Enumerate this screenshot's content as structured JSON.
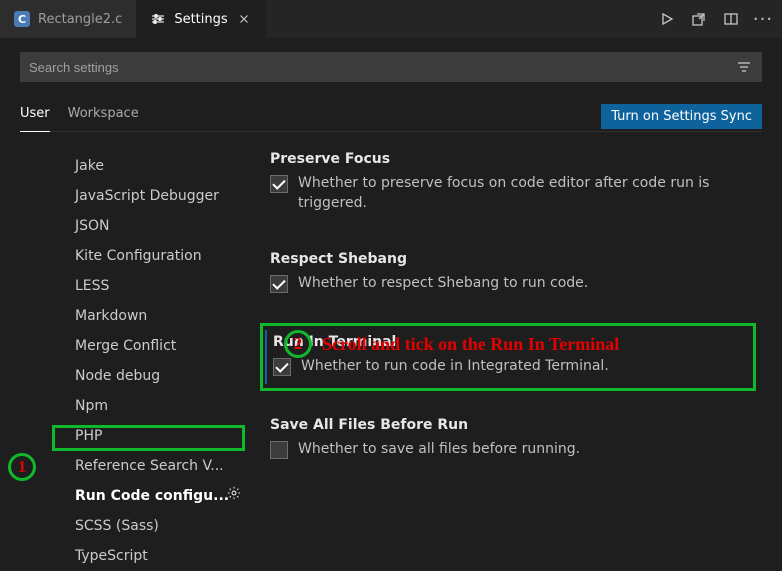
{
  "tabs": [
    {
      "label": "Rectangle2.c",
      "badge": "C",
      "active": false
    },
    {
      "label": "Settings",
      "active": true
    }
  ],
  "search": {
    "placeholder": "Search settings"
  },
  "scope": {
    "user": "User",
    "workspace": "Workspace",
    "sync_button": "Turn on Settings Sync"
  },
  "toc": [
    "Jake",
    "JavaScript Debugger",
    "JSON",
    "Kite Configuration",
    "LESS",
    "Markdown",
    "Merge Conflict",
    "Node debug",
    "Npm",
    "PHP",
    "Reference Search V...",
    "Run Code configu...",
    "SCSS (Sass)",
    "TypeScript"
  ],
  "settings": {
    "preserve_focus": {
      "title": "Preserve Focus",
      "desc": "Whether to preserve focus on code editor after code run is triggered.",
      "checked": true
    },
    "respect_shebang": {
      "title": "Respect Shebang",
      "desc": "Whether to respect Shebang to run code.",
      "checked": true
    },
    "run_in_terminal": {
      "title": "Run In Terminal",
      "desc": "Whether to run code in Integrated Terminal.",
      "checked": true
    },
    "save_all": {
      "title": "Save All Files Before Run",
      "desc": "Whether to save all files before running.",
      "checked": false
    }
  },
  "annotations": {
    "one": "1",
    "two_num": "2",
    "two_text": "Scroll and tick on the Run In Terminal"
  }
}
